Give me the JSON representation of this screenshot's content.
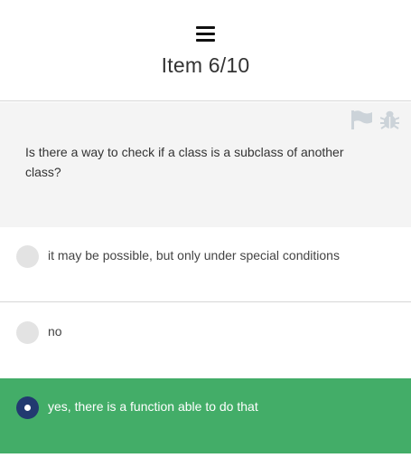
{
  "header": {
    "menu_icon": "hamburger-menu-icon",
    "item_counter": "Item 6/10"
  },
  "question": {
    "text": "Is there a way to check if a class is a subclass of another class?",
    "icons": [
      "flag-icon",
      "bug-icon"
    ]
  },
  "options": [
    {
      "label": "it may be possible, but only under special conditions",
      "selected": false
    },
    {
      "label": "no",
      "selected": false
    },
    {
      "label": "yes, there is a function able to do that",
      "selected": true
    }
  ],
  "colors": {
    "selected_background": "#43ad68",
    "selected_radio": "#223a70",
    "question_background": "#f4f4f4",
    "unselected_radio": "#e3e3e3"
  }
}
